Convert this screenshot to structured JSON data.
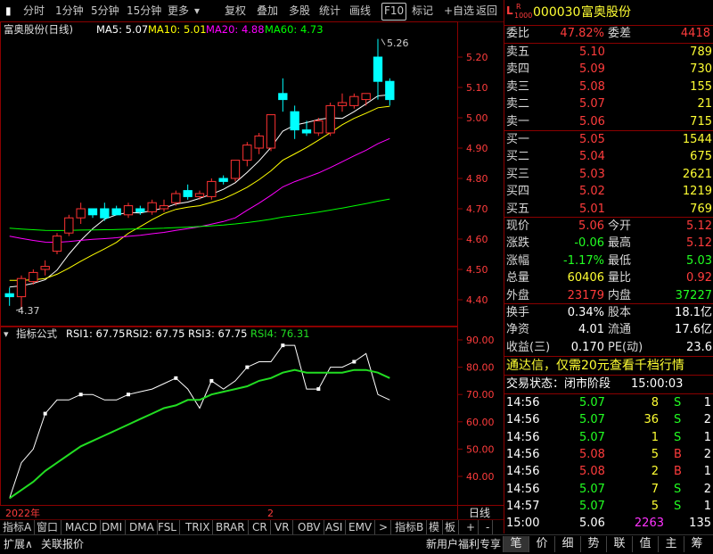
{
  "toolbar": {
    "items": [
      "分时",
      "1分钟",
      "5分钟",
      "15分钟",
      "更多",
      "复权",
      "叠加",
      "多股",
      "统计",
      "画线",
      "F10",
      "标记",
      "+自选",
      "返回"
    ]
  },
  "kchart": {
    "stock_title": "富奥股份(日线)",
    "ma5": "MA5: 5.07",
    "ma10": "MA10: 5.01",
    "ma20": "MA20: 4.88",
    "ma60": "MA60: 4.73",
    "y_ticks": [
      "5.20",
      "5.10",
      "5.00",
      "4.90",
      "4.80",
      "4.70",
      "4.60",
      "4.50",
      "4.40"
    ],
    "high_label": "5.26",
    "low_label": "4.37",
    "colors": {
      "up": "#ff3232",
      "down": "#00ffff",
      "ma5": "#ffffff",
      "ma10": "#ffff00",
      "ma20": "#ff00ff",
      "ma60": "#00ff00"
    }
  },
  "chart_data": [
    {
      "type": "candlestick",
      "ylim": [
        4.37,
        5.26
      ],
      "candles": [
        {
          "o": 4.42,
          "h": 4.44,
          "l": 4.38,
          "c": 4.41
        },
        {
          "o": 4.41,
          "h": 4.48,
          "l": 4.37,
          "c": 4.47
        },
        {
          "o": 4.46,
          "h": 4.5,
          "l": 4.45,
          "c": 4.49
        },
        {
          "o": 4.5,
          "h": 4.53,
          "l": 4.48,
          "c": 4.51
        },
        {
          "o": 4.56,
          "h": 4.62,
          "l": 4.55,
          "c": 4.61
        },
        {
          "o": 4.62,
          "h": 4.68,
          "l": 4.61,
          "c": 4.67
        },
        {
          "o": 4.67,
          "h": 4.72,
          "l": 4.65,
          "c": 4.7
        },
        {
          "o": 4.7,
          "h": 4.7,
          "l": 4.67,
          "c": 4.68
        },
        {
          "o": 4.7,
          "h": 4.72,
          "l": 4.66,
          "c": 4.67
        },
        {
          "o": 4.7,
          "h": 4.71,
          "l": 4.68,
          "c": 4.68
        },
        {
          "o": 4.68,
          "h": 4.72,
          "l": 4.67,
          "c": 4.71
        },
        {
          "o": 4.7,
          "h": 4.71,
          "l": 4.68,
          "c": 4.69
        },
        {
          "o": 4.69,
          "h": 4.73,
          "l": 4.68,
          "c": 4.72
        },
        {
          "o": 4.7,
          "h": 4.73,
          "l": 4.69,
          "c": 4.71
        },
        {
          "o": 4.72,
          "h": 4.76,
          "l": 4.71,
          "c": 4.75
        },
        {
          "o": 4.76,
          "h": 4.78,
          "l": 4.73,
          "c": 4.74
        },
        {
          "o": 4.74,
          "h": 4.76,
          "l": 4.73,
          "c": 4.75
        },
        {
          "o": 4.74,
          "h": 4.8,
          "l": 4.73,
          "c": 4.79
        },
        {
          "o": 4.8,
          "h": 4.81,
          "l": 4.78,
          "c": 4.79
        },
        {
          "o": 4.8,
          "h": 4.86,
          "l": 4.79,
          "c": 4.86
        },
        {
          "o": 4.86,
          "h": 4.92,
          "l": 4.84,
          "c": 4.91
        },
        {
          "o": 4.9,
          "h": 4.95,
          "l": 4.88,
          "c": 4.94
        },
        {
          "o": 4.9,
          "h": 5.0,
          "l": 4.89,
          "c": 5.01
        },
        {
          "o": 5.08,
          "h": 5.13,
          "l": 5.02,
          "c": 5.06
        },
        {
          "o": 5.02,
          "h": 5.04,
          "l": 4.93,
          "c": 4.96
        },
        {
          "o": 4.96,
          "h": 4.99,
          "l": 4.94,
          "c": 4.95
        },
        {
          "o": 4.95,
          "h": 5.0,
          "l": 4.94,
          "c": 4.99
        },
        {
          "o": 4.95,
          "h": 5.05,
          "l": 4.94,
          "c": 5.04
        },
        {
          "o": 5.04,
          "h": 5.08,
          "l": 5.02,
          "c": 5.05
        },
        {
          "o": 5.04,
          "h": 5.08,
          "l": 5.03,
          "c": 5.07
        },
        {
          "o": 5.06,
          "h": 5.08,
          "l": 5.04,
          "c": 5.08
        },
        {
          "o": 5.2,
          "h": 5.26,
          "l": 5.06,
          "c": 5.12
        },
        {
          "o": 5.12,
          "h": 5.13,
          "l": 5.04,
          "c": 5.06
        }
      ]
    },
    {
      "type": "line",
      "title": "指标公式",
      "series": [
        {
          "name": "RSI1: 67.75",
          "color": "#ffffff",
          "values": [
            32,
            45,
            50,
            63,
            68,
            68,
            70,
            70,
            68,
            68,
            70,
            71,
            72,
            74,
            76,
            72,
            65,
            75,
            72,
            75,
            80,
            82,
            82,
            88,
            88,
            72,
            72,
            80,
            80,
            82,
            85,
            70,
            68
          ]
        },
        {
          "name": "RSI4: 76.31",
          "color": "#22dd22",
          "values": [
            32,
            35,
            38,
            42,
            45,
            48,
            51,
            53,
            55,
            57,
            59,
            61,
            63,
            65,
            66,
            68,
            68,
            70,
            71,
            72,
            73,
            75,
            76,
            78,
            79,
            78,
            78,
            78,
            78,
            79,
            79,
            78,
            76
          ]
        }
      ],
      "labels_extra": [
        "RSI2: 67.75",
        "RSI3: 67.75"
      ],
      "ylim": [
        32,
        92
      ],
      "y_ticks": [
        "90.00",
        "80.00",
        "70.00",
        "60.00",
        "50.00",
        "40.00"
      ],
      "x_labels": [
        "2022年",
        "2"
      ],
      "bottom_right_label": "日线"
    }
  ],
  "bottom_tabs": [
    "指标A",
    "窗口",
    "MACD",
    "DMI",
    "DMA",
    "FSL",
    "TRIX",
    "BRAR",
    "CR",
    "VR",
    "OBV",
    "ASI",
    "EMV",
    ">",
    "指标B",
    "模",
    "板",
    "+",
    "-"
  ],
  "status": {
    "left1": "扩展∧",
    "left2": "关联报价",
    "mid": "新用户福利专享",
    "right_tabs": [
      "笔",
      "价",
      "细",
      "势",
      "联",
      "值",
      "主",
      "筹"
    ]
  },
  "panel": {
    "badge_L": "L",
    "badge_R": "R",
    "badge_num": "1000",
    "code": "000030",
    "name": "富奥股份",
    "weibi_label": "委比",
    "weibi": "47.82%",
    "weicha_label": "委差",
    "weicha": "4418",
    "sells": [
      {
        "label": "卖五",
        "price": "5.10",
        "vol": "789"
      },
      {
        "label": "卖四",
        "price": "5.09",
        "vol": "730"
      },
      {
        "label": "卖三",
        "price": "5.08",
        "vol": "155"
      },
      {
        "label": "卖二",
        "price": "5.07",
        "vol": "21"
      },
      {
        "label": "卖一",
        "price": "5.06",
        "vol": "715"
      }
    ],
    "buys": [
      {
        "label": "买一",
        "price": "5.05",
        "vol": "1544"
      },
      {
        "label": "买二",
        "price": "5.04",
        "vol": "675"
      },
      {
        "label": "买三",
        "price": "5.03",
        "vol": "2621"
      },
      {
        "label": "买四",
        "price": "5.02",
        "vol": "1219"
      },
      {
        "label": "买五",
        "price": "5.01",
        "vol": "769"
      }
    ],
    "quote": [
      {
        "l1": "现价",
        "v1": "5.06",
        "l2": "今开",
        "v2": "5.12"
      },
      {
        "l1": "涨跌",
        "v1": "-0.06",
        "l2": "最高",
        "v2": "5.12"
      },
      {
        "l1": "涨幅",
        "v1": "-1.17%",
        "l2": "最低",
        "v2": "5.03"
      },
      {
        "l1": "总量",
        "v1": "60406",
        "l2": "量比",
        "v2": "0.92"
      },
      {
        "l1": "外盘",
        "v1": "23179",
        "l2": "内盘",
        "v2": "37227"
      }
    ],
    "fin": [
      {
        "l1": "换手",
        "v1": "0.34%",
        "l2": "股本",
        "v2": "18.1亿"
      },
      {
        "l1": "净资",
        "v1": "4.01",
        "l2": "流通",
        "v2": "17.6亿"
      },
      {
        "l1": "收益(三)",
        "v1": "0.170",
        "l2": "PE(动)",
        "v2": "23.6"
      }
    ],
    "ad": "通达信，仅需20元查看千档行情",
    "trade_state_label": "交易状态：闭市阶段",
    "trade_state_time": "15:00:03",
    "ticks": [
      {
        "t": "14:56",
        "p": "5.07",
        "v": "8",
        "s": "S",
        "n": "1"
      },
      {
        "t": "14:56",
        "p": "5.07",
        "v": "36",
        "s": "S",
        "n": "2"
      },
      {
        "t": "14:56",
        "p": "5.07",
        "v": "1",
        "s": "S",
        "n": "1"
      },
      {
        "t": "14:56",
        "p": "5.08",
        "v": "5",
        "s": "B",
        "n": "2"
      },
      {
        "t": "14:56",
        "p": "5.08",
        "v": "2",
        "s": "B",
        "n": "1"
      },
      {
        "t": "14:56",
        "p": "5.07",
        "v": "7",
        "s": "S",
        "n": "2"
      },
      {
        "t": "14:57",
        "p": "5.07",
        "v": "5",
        "s": "S",
        "n": "1"
      },
      {
        "t": "15:00",
        "p": "5.06",
        "v": "2263",
        "s": "",
        "n": "135"
      }
    ]
  }
}
